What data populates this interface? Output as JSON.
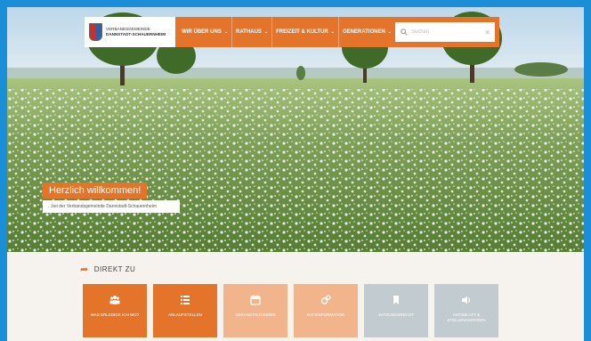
{
  "header": {
    "logo_line1": "VERBANDSGEMEINDE",
    "logo_line2": "DANNSTADT-SCHAUERNHEIM",
    "nav": [
      {
        "label": "WIR ÜBER UNS"
      },
      {
        "label": "RATHAUS"
      },
      {
        "label": "FREIZEIT & KULTUR"
      },
      {
        "label": "GENERATIONEN"
      }
    ],
    "search_placeholder": "Suchen",
    "search_clear": "×"
  },
  "hero": {
    "title": "Herzlich willkommen!",
    "subtitle": "...bei der Verbandsgemeinde Dannstadt-Schauernheim"
  },
  "direct": {
    "title": "DIREKT ZU"
  },
  "tiles": [
    {
      "label": "WAS ERLEDIGE ICH WO?",
      "color": "#e5742b",
      "icon": "people-icon"
    },
    {
      "label": "ANLAUFSTELLEN",
      "color": "#e5742b",
      "icon": "list-icon"
    },
    {
      "label": "VERANSTALTUNGEN",
      "color": "#f2b48a",
      "icon": "calendar-icon"
    },
    {
      "label": "RATSINFORMATION",
      "color": "#f2b48a",
      "icon": "cogs-icon"
    },
    {
      "label": "SATZUNGSRECHT",
      "color": "#c2ccd0",
      "icon": "bookmark-icon"
    },
    {
      "label": "AMTSBLATT & STELLENANZEIGEN",
      "color": "#c2ccd0",
      "icon": "speaker-icon"
    }
  ]
}
